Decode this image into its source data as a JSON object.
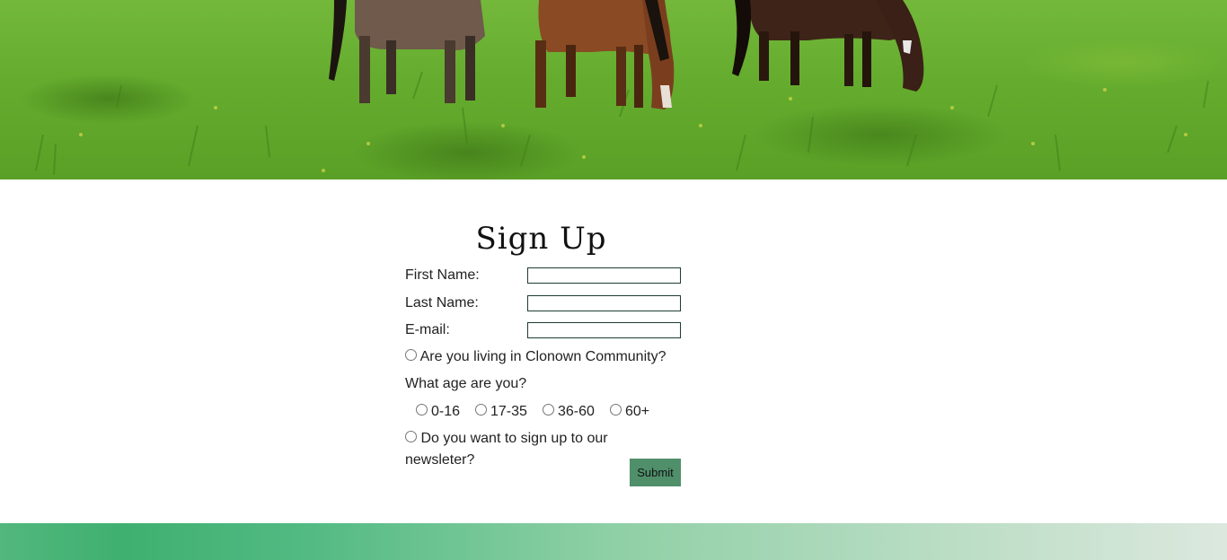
{
  "colors": {
    "grass": "#65ac2e",
    "submit_bg": "#4f8f6a",
    "input_border": "#1d3d2e",
    "footer_start": "#3fb070",
    "footer_end": "#dce8de"
  },
  "hero": {
    "icon": "grazing-horses-image"
  },
  "signup": {
    "title": "Sign Up",
    "first_name_label": "First Name:",
    "first_name_value": "",
    "last_name_label": "Last Name:",
    "last_name_value": "",
    "email_label": "E-mail:",
    "email_value": "",
    "community_question": "Are you living in Clonown Community?",
    "age_question": "What age are you?",
    "age_options": [
      "0-16",
      "17-35",
      "36-60",
      "60+"
    ],
    "newsletter_question": "Do you want to sign up to our newsleter?",
    "submit_label": "Submit"
  }
}
